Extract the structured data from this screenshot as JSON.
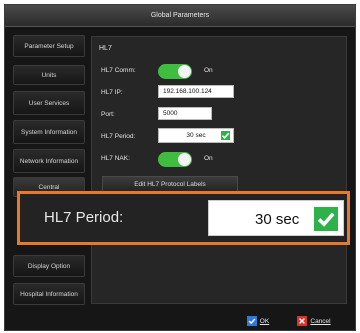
{
  "dialog": {
    "title": "Global Parameters"
  },
  "sidebar": {
    "items": [
      {
        "label": "Parameter Setup"
      },
      {
        "label": "Units"
      },
      {
        "label": "User Services"
      },
      {
        "label": "System Information"
      },
      {
        "label": "Network Information"
      },
      {
        "label": "Central"
      },
      {
        "label": "Display Option"
      },
      {
        "label": "Hospital Information"
      }
    ]
  },
  "panel": {
    "title": "HL7",
    "hl7_comm": {
      "label": "HL7 Comm:",
      "state": "On",
      "enabled": true
    },
    "hl7_ip": {
      "label": "HL7 IP:",
      "value": "192.168.100.124"
    },
    "port": {
      "label": "Port:",
      "value": "5000"
    },
    "hl7_period": {
      "label": "HL7 Period:",
      "value": "30 sec"
    },
    "hl7_nak": {
      "label": "HL7 NAK:",
      "state": "On",
      "enabled": true
    },
    "edit_labels_button": "Edit HL7 Protocol Labels"
  },
  "callout": {
    "label": "HL7 Period:",
    "value": "30 sec"
  },
  "footer": {
    "ok": "OK",
    "cancel": "Cancel"
  },
  "colors": {
    "accent_orange": "#e8792c",
    "toggle_green": "#3fbd3f",
    "check_green": "#2db24a",
    "ok_blue": "#2f7ad8",
    "cancel_red": "#d9332b"
  }
}
